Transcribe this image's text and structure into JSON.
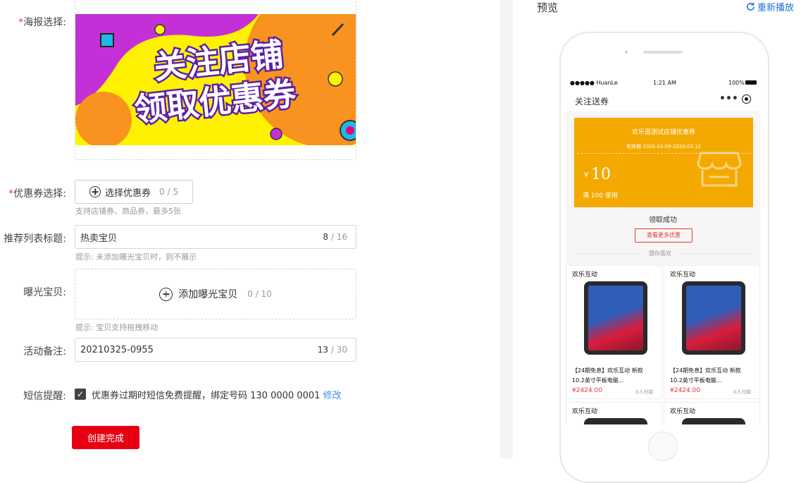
{
  "form": {
    "poster_label": "海报选择:",
    "poster_text_line1": "关注店铺",
    "poster_text_line2": "领取优惠券",
    "coupon_label": "优惠券选择:",
    "coupon_btn": "选择优惠券",
    "coupon_count": "0 / 5",
    "coupon_hint": "支持店铺券、商品券，最多5张",
    "recommend_label": "推荐列表标题:",
    "recommend_value": "热卖宝贝",
    "recommend_count_cur": "8",
    "recommend_count_max": " / 16",
    "recommend_hint": "提示: 未添加曝光宝贝时，则不展示",
    "expose_label": "曝光宝贝:",
    "expose_btn": "添加曝光宝贝",
    "expose_count": "0 / 10",
    "expose_hint": "提示: 宝贝支持拖拽移动",
    "note_label": "活动备注:",
    "note_value": "20210325-0955",
    "note_count_cur": "13",
    "note_count_max": " / 30",
    "sms_label": "短信提醒:",
    "sms_text": "优惠券过期时短信免费提醒，绑定号码 130 0000 0001",
    "sms_link": "修改",
    "submit": "创建完成"
  },
  "preview": {
    "title": "预览",
    "replay": "重新播放",
    "status_carrier": "●●●●● HuanLe",
    "status_time": "1:21 AM",
    "status_battery": "100%",
    "nav_title": "关注送券",
    "coupon_shop": "欢乐逛测试店铺优惠券",
    "coupon_validity": "有效期 2020.03.09-2020.03.12",
    "coupon_currency": "¥",
    "coupon_amount": "10",
    "coupon_condition": "满 100 使用",
    "received": "领取成功",
    "more_btn": "查看更多优惠",
    "guess": "猜你喜欢",
    "goods": [
      {
        "brand": "欢乐互动",
        "title_line1": "【24期免息】欢乐互动 新款",
        "title_line2": "10.2英寸平板电脑...",
        "price": "¥2424.00",
        "sold": "0人付款"
      },
      {
        "brand": "欢乐互动",
        "title_line1": "【24期免息】欢乐互动 新款",
        "title_line2": "10.2英寸平板电脑...",
        "price": "¥2424.00",
        "sold": "0人付款"
      },
      {
        "brand": "欢乐互动"
      },
      {
        "brand": "欢乐互动"
      }
    ]
  }
}
